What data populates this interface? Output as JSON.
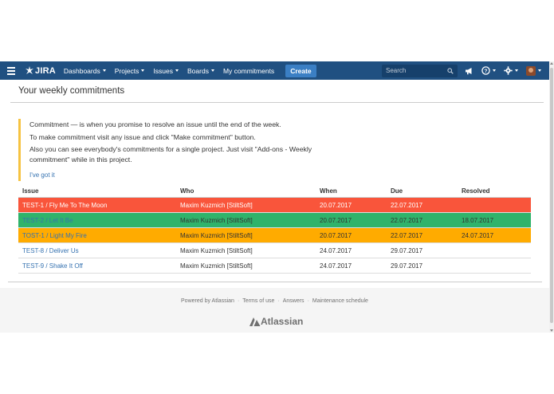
{
  "nav": {
    "logo_text": "JIRA",
    "items": [
      {
        "label": "Dashboards",
        "dropdown": true
      },
      {
        "label": "Projects",
        "dropdown": true
      },
      {
        "label": "Issues",
        "dropdown": true
      },
      {
        "label": "Boards",
        "dropdown": true
      },
      {
        "label": "My commitments",
        "dropdown": false
      }
    ],
    "create_label": "Create",
    "search_placeholder": "Search",
    "bar_color": "#205081"
  },
  "page": {
    "title": "Your weekly commitments"
  },
  "message": {
    "lines": [
      "Commitment — is when you promise to resolve an issue until the end of the week.",
      "To make commitment visit any issue and click \"Make commitment\" button.",
      "Also you can see everybody's commitments for a single project. Just visit \"Add-ons - Weekly commitment\" while in this project."
    ],
    "dismiss_label": "I've got it",
    "accent_color": "#f6c342"
  },
  "table": {
    "headers": [
      "Issue",
      "Who",
      "When",
      "Due",
      "Resolved"
    ],
    "rows": [
      {
        "issue": "TEST-1 / Fly Me To The Moon",
        "who": "Maxim Kuzmich [StiltSoft]",
        "when": "20.07.2017",
        "due": "22.07.2017",
        "resolved": "",
        "status": "red"
      },
      {
        "issue": "TEST-2 / Let It Be",
        "who": "Maxim Kuzmich [StiltSoft]",
        "when": "20.07.2017",
        "due": "22.07.2017",
        "resolved": "18.07.2017",
        "status": "green"
      },
      {
        "issue": "TOST-1 / Light My Fire",
        "who": "Maxim Kuzmich [StiltSoft]",
        "when": "20.07.2017",
        "due": "22.07.2017",
        "resolved": "24.07.2017",
        "status": "orange"
      },
      {
        "issue": "TEST-8 / Deliver Us",
        "who": "Maxim Kuzmich [StiltSoft]",
        "when": "24.07.2017",
        "due": "29.07.2017",
        "resolved": "",
        "status": "none"
      },
      {
        "issue": "TEST-9 / Shake It Off",
        "who": "Maxim Kuzmich [StiltSoft]",
        "when": "24.07.2017",
        "due": "29.07.2017",
        "resolved": "",
        "status": "none"
      }
    ],
    "colors": {
      "red": "#f9553b",
      "green": "#2fb36b",
      "orange": "#ffab00"
    }
  },
  "footer": {
    "links": [
      "Powered by Atlassian",
      "Terms of use",
      "Answers",
      "Maintenance schedule"
    ],
    "logo_text": "Atlassian"
  }
}
